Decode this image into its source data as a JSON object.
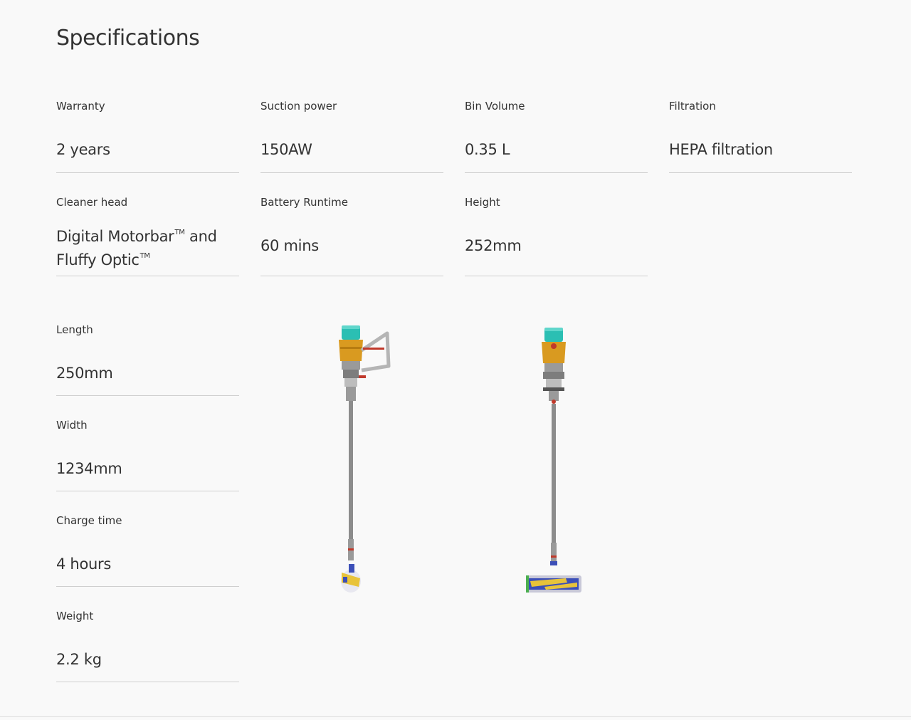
{
  "page_title": "Specifications",
  "specs": {
    "warranty": {
      "label": "Warranty",
      "value": "2 years"
    },
    "suction": {
      "label": "Suction power",
      "value": "150AW"
    },
    "bin": {
      "label": "Bin Volume",
      "value": "0.35 L"
    },
    "filtration": {
      "label": "Filtration",
      "value": "HEPA filtration"
    },
    "cleaner_head": {
      "label": "Cleaner head",
      "value_line1": "Digital Motorbar",
      "tm1": "TM",
      "value_and": " and",
      "value_line2": "Fluffy Optic",
      "tm2": "TM"
    },
    "battery": {
      "label": "Battery Runtime",
      "value": "60 mins"
    },
    "height": {
      "label": "Height",
      "value": "252mm"
    },
    "length": {
      "label": "Length",
      "value": "250mm"
    },
    "width": {
      "label": "Width",
      "value": "1234mm"
    },
    "charge": {
      "label": "Charge time",
      "value": "4 hours"
    },
    "weight": {
      "label": "Weight",
      "value": "2.2 kg"
    }
  },
  "colors": {
    "background": "#f9f9f9",
    "text": "#333333",
    "divider": "#cfcfcf",
    "vacuum_bin": "#2bbfb3",
    "vacuum_body": "#d99a20",
    "vacuum_rod": "#8c8c8c",
    "vacuum_head_blue": "#3c4fb8",
    "vacuum_head_yellow": "#e8c33a"
  }
}
